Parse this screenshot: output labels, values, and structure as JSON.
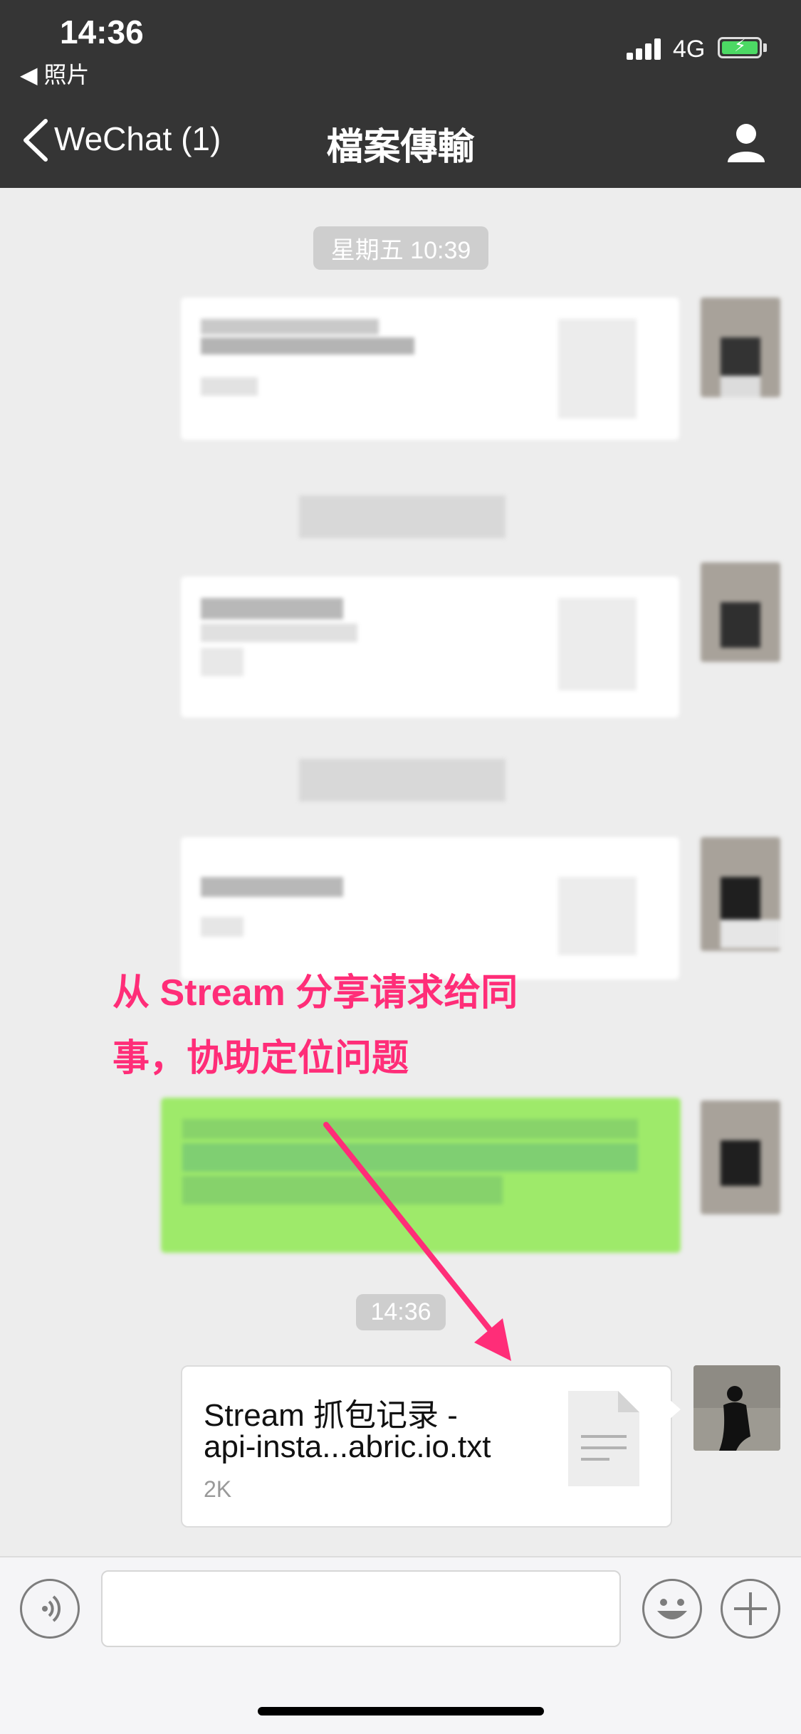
{
  "status_bar": {
    "time": "14:36",
    "back_app": "◀ 照片",
    "network": "4G"
  },
  "nav": {
    "back_label": "WeChat (1)",
    "title": "檔案傳輸"
  },
  "chat": {
    "timestamp_1": "星期五 10:39",
    "timestamp_2": "14:36"
  },
  "annotation": {
    "line1": "从 Stream 分享请求给同",
    "line2": "事，协助定位问题",
    "color": "#ff2d78"
  },
  "file_message": {
    "name_line1": "Stream 抓包记录 -",
    "name_line2": "api-insta...abric.io.txt",
    "size": "2K"
  },
  "icons": [
    "chevron-left-icon",
    "person-icon",
    "voice-icon",
    "emoji-icon",
    "plus-icon",
    "file-icon"
  ],
  "colors": {
    "nav_bg": "#353535",
    "chat_bg": "#ededed",
    "sent_bubble": "#9eea6a"
  }
}
